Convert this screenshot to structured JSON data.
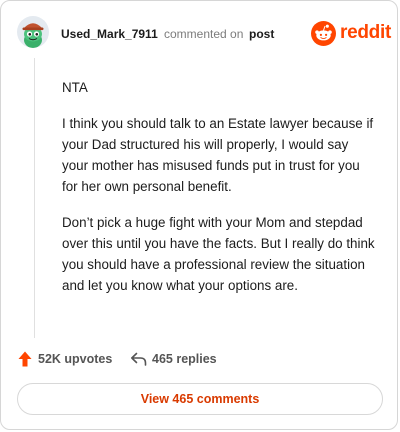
{
  "comment": {
    "author": "Used_Mark_7911",
    "action_text": "commented on",
    "post_link_label": "post",
    "brand_name": "reddit",
    "brand_color": "#ff4500",
    "paragraphs": [
      "NTA",
      "I think you should talk to an Estate lawyer because if your Dad structured his will properly, I would say your mother has misused funds put in trust for you for her own personal benefit.",
      "Don’t pick a huge fight with your Mom and stepdad over this until you have the facts. But I really do think you should have a professional review the situation and let you know what your options are."
    ]
  },
  "footer": {
    "upvotes_label": "52K upvotes",
    "replies_label": "465 replies",
    "view_button_label": "View 465 comments",
    "upvote_icon": "upvote-arrow-icon",
    "reply_icon": "reply-arrow-icon",
    "accent_color": "#d93a00"
  }
}
